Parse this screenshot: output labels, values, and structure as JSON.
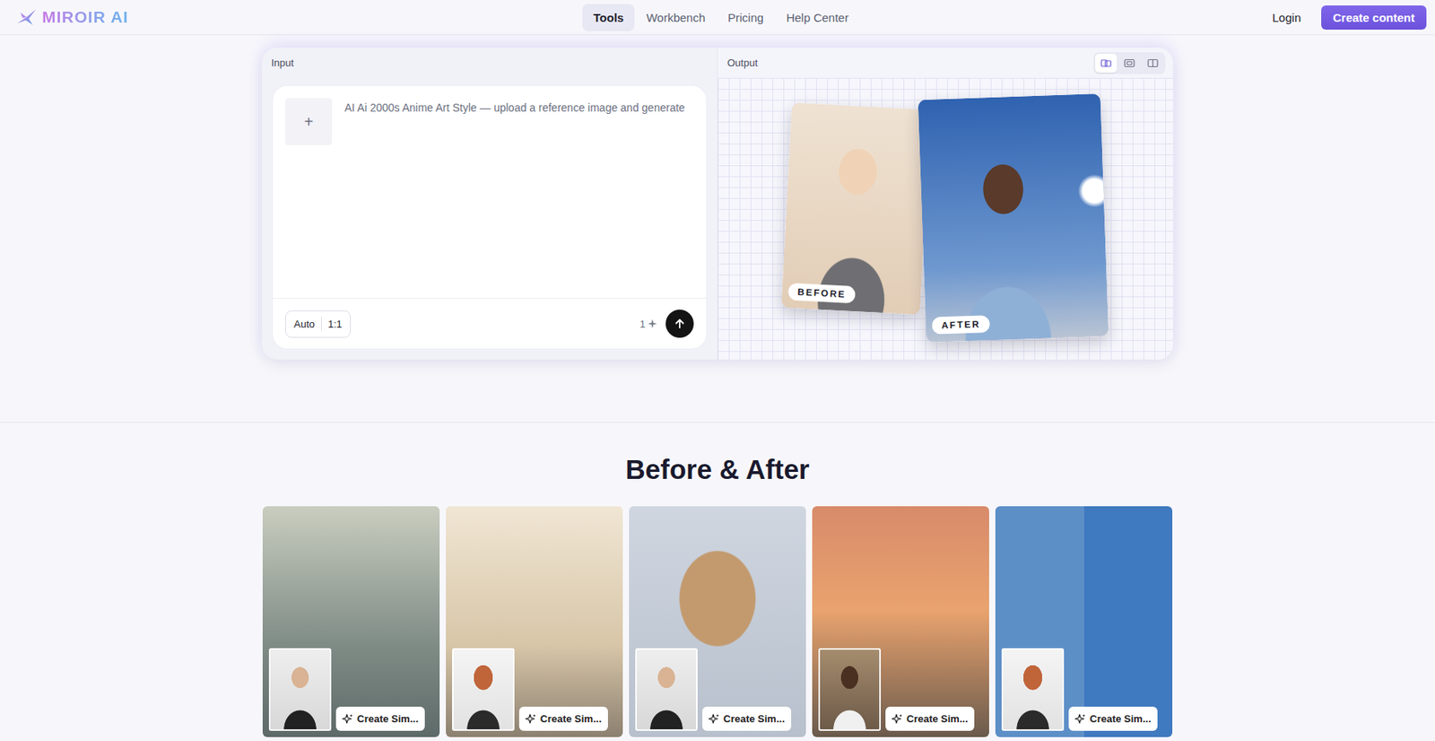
{
  "logo": {
    "text": "MIROIR AI"
  },
  "nav": [
    {
      "label": "Tools",
      "selected": true
    },
    {
      "label": "Workbench",
      "selected": false
    },
    {
      "label": "Pricing",
      "selected": false
    },
    {
      "label": "Help Center",
      "selected": false
    }
  ],
  "header_actions": {
    "login": "Login",
    "cta": "Create content"
  },
  "input": {
    "title": "Input",
    "upload_icon": "+",
    "placeholder": "AI Ai 2000s Anime Art Style — upload a reference image and generate",
    "mode": "Auto",
    "ratio": "1:1",
    "count": "1"
  },
  "output": {
    "title": "Output",
    "views": [
      {
        "kind": "compare",
        "selected": true
      },
      {
        "kind": "split",
        "selected": false
      },
      {
        "kind": "side",
        "selected": false
      }
    ],
    "before_label": "BEFORE",
    "after_label": "AFTER"
  },
  "gallery": {
    "title": "Before & After",
    "cards": [
      {
        "button": "Create Sim..."
      },
      {
        "button": "Create Sim..."
      },
      {
        "button": "Create Sim..."
      },
      {
        "button": "Create Sim..."
      },
      {
        "button": "Create Sim..."
      }
    ]
  }
}
